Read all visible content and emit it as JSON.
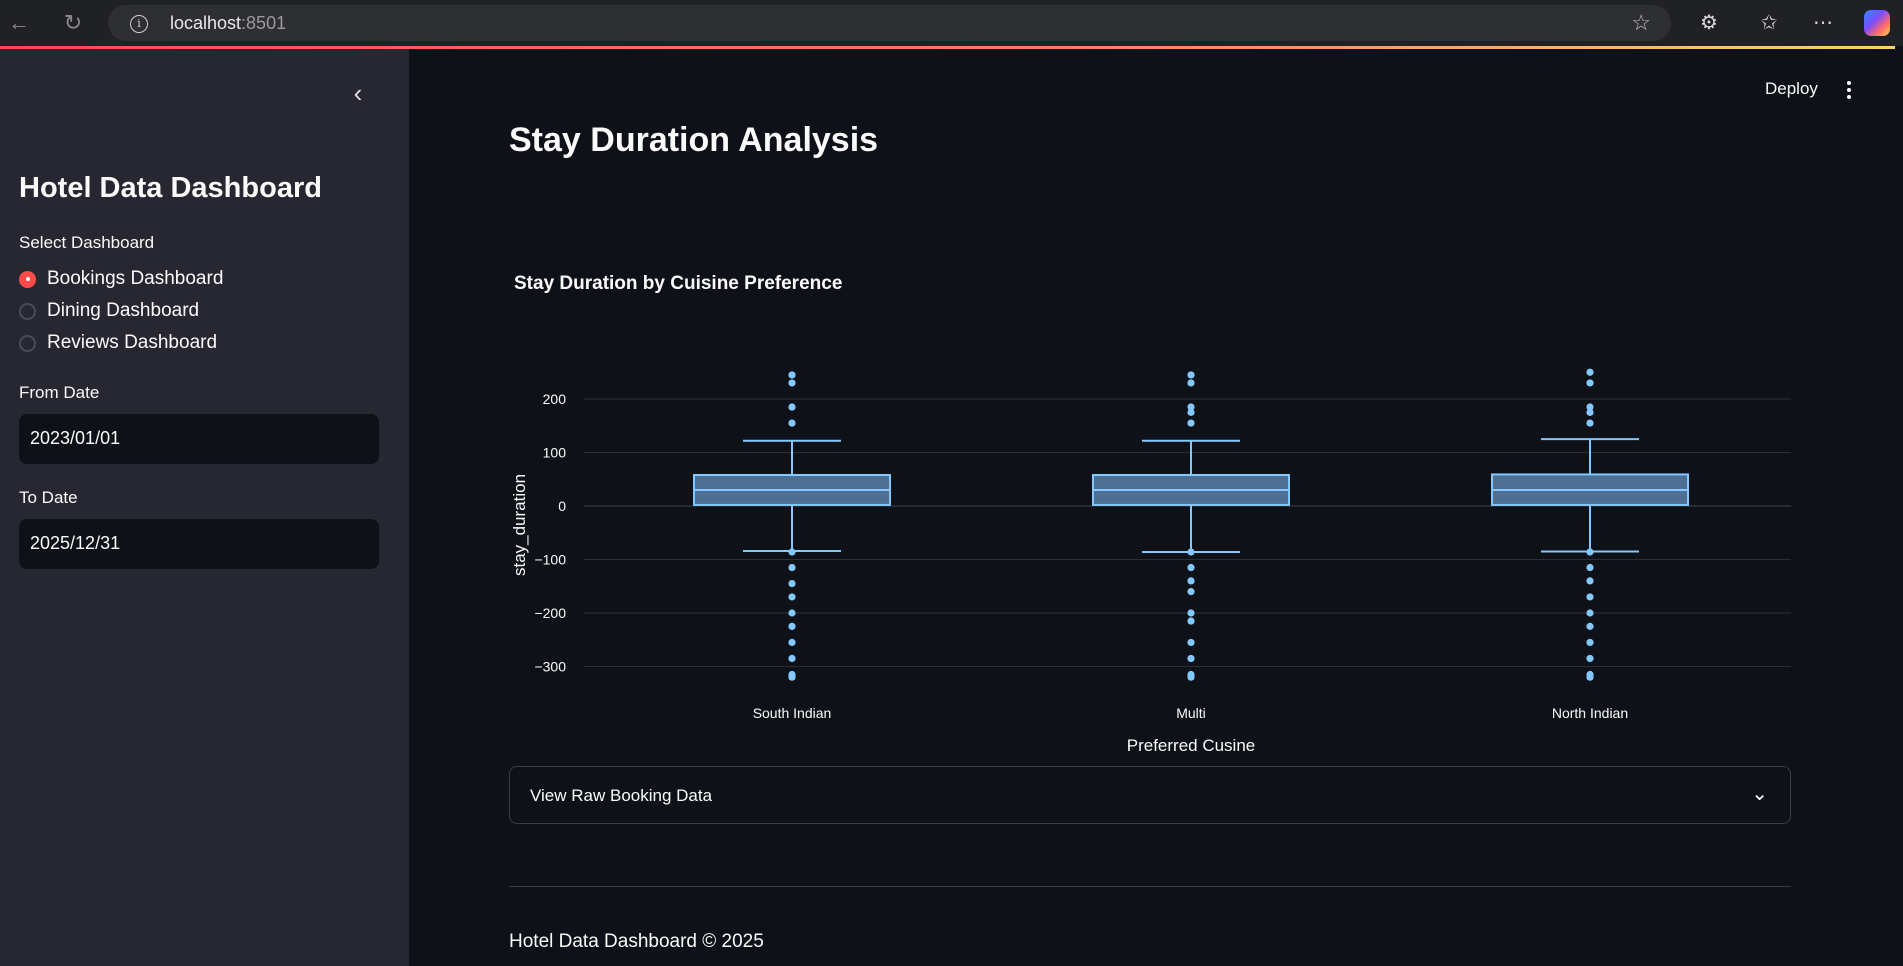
{
  "browser": {
    "url_host": "localhost",
    "url_port": ":8501"
  },
  "sidebar": {
    "title": "Hotel Data Dashboard",
    "select_label": "Select Dashboard",
    "options": [
      {
        "label": "Bookings Dashboard",
        "selected": true
      },
      {
        "label": "Dining Dashboard",
        "selected": false
      },
      {
        "label": "Reviews Dashboard",
        "selected": false
      }
    ],
    "from_label": "From Date",
    "from_value": "2023/01/01",
    "to_label": "To Date",
    "to_value": "2025/12/31"
  },
  "header": {
    "deploy_label": "Deploy"
  },
  "main": {
    "title": "Stay Duration Analysis",
    "expander_label": "View Raw Booking Data",
    "footer": "Hotel Data Dashboard © 2025"
  },
  "colors": {
    "accent": "#ff4b4b",
    "box_fill": "#4d6f94",
    "box_line": "#83c9ff",
    "background": "#0e1117",
    "sidebar": "#262730"
  },
  "chart_data": {
    "type": "box",
    "title": "Stay Duration by Cuisine Preference",
    "xlabel": "Preferred Cusine",
    "ylabel": "stay_duration",
    "ylim": [
      -325,
      255
    ],
    "yticks": [
      200,
      100,
      0,
      -100,
      -200,
      -300
    ],
    "ytick_labels": [
      "200",
      "100",
      "0",
      "−100",
      "−200",
      "−300"
    ],
    "grid": true,
    "categories": [
      "South Indian",
      "Multi",
      "North Indian"
    ],
    "boxes": [
      {
        "category": "South Indian",
        "q1": 2,
        "median": 30,
        "q3": 58,
        "lower_fence": -84,
        "upper_fence": 122,
        "outliers": [
          245,
          230,
          185,
          155,
          -86,
          -115,
          -145,
          -170,
          -200,
          -225,
          -255,
          -285,
          -315,
          -320
        ]
      },
      {
        "category": "Multi",
        "q1": 2,
        "median": 30,
        "q3": 58,
        "lower_fence": -86,
        "upper_fence": 122,
        "outliers": [
          245,
          230,
          185,
          175,
          155,
          -86,
          -115,
          -140,
          -160,
          -200,
          -215,
          -255,
          -285,
          -315,
          -320
        ]
      },
      {
        "category": "North Indian",
        "q1": 2,
        "median": 30,
        "q3": 59,
        "lower_fence": -85,
        "upper_fence": 125,
        "outliers": [
          250,
          230,
          185,
          175,
          155,
          -86,
          -115,
          -140,
          -170,
          -200,
          -225,
          -255,
          -285,
          -315,
          -320
        ]
      }
    ]
  }
}
